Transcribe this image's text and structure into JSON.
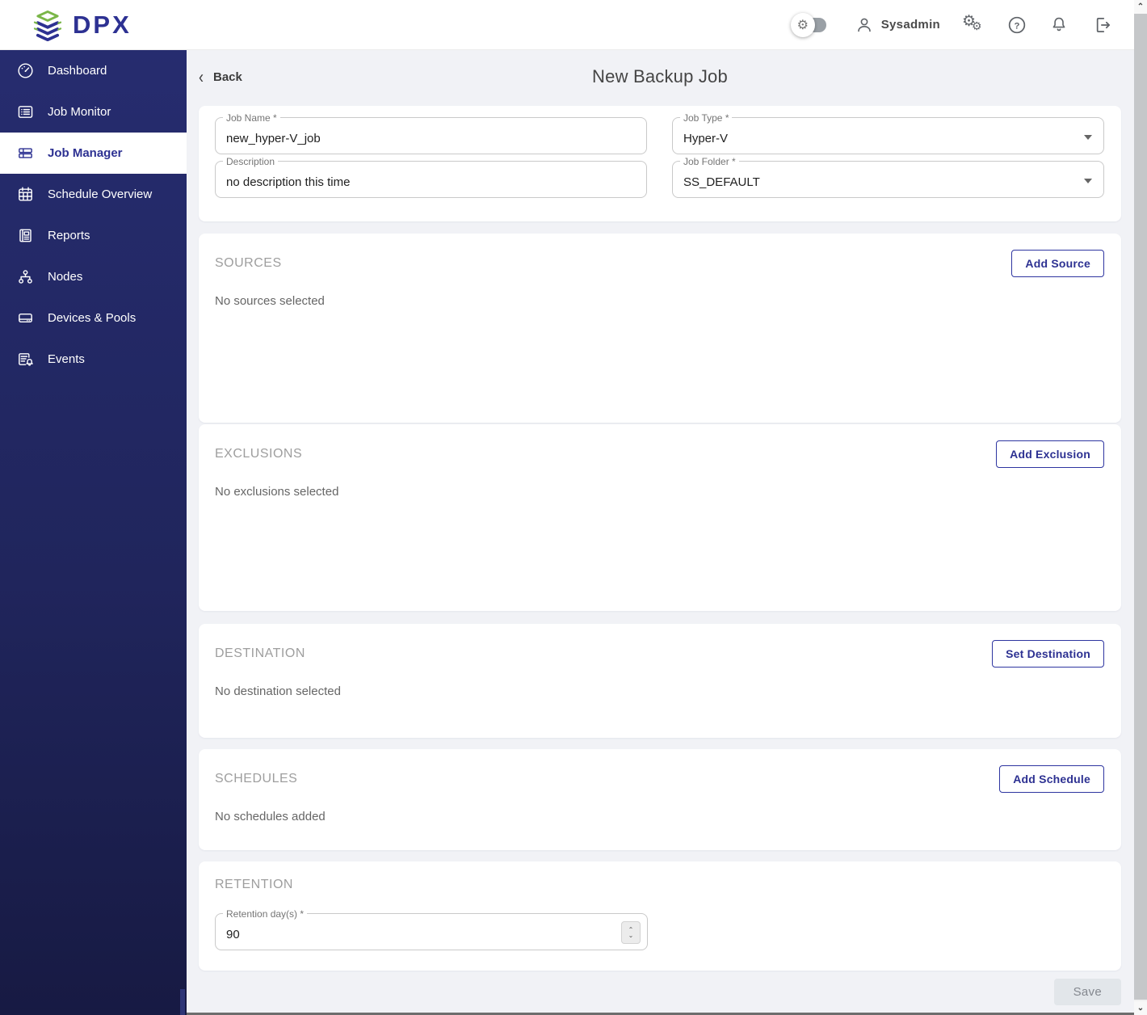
{
  "header": {
    "logo_text": "DPX",
    "user_name": "Sysadmin",
    "icons": {
      "toggle_knob": "gear-toggle-icon",
      "user": "person-icon",
      "settings": "double-gear-icon",
      "help": "question-circle-icon",
      "notifications": "bell-icon",
      "logout": "logout-icon"
    }
  },
  "sidebar": {
    "items": [
      {
        "label": "Dashboard",
        "icon": "dashboard-icon",
        "active": false
      },
      {
        "label": "Job Monitor",
        "icon": "job-monitor-icon",
        "active": false
      },
      {
        "label": "Job Manager",
        "icon": "job-manager-icon",
        "active": true
      },
      {
        "label": "Schedule Overview",
        "icon": "schedule-icon",
        "active": false
      },
      {
        "label": "Reports",
        "icon": "reports-icon",
        "active": false
      },
      {
        "label": "Nodes",
        "icon": "nodes-icon",
        "active": false
      },
      {
        "label": "Devices & Pools",
        "icon": "devices-icon",
        "active": false
      },
      {
        "label": "Events",
        "icon": "events-icon",
        "active": false
      }
    ]
  },
  "page": {
    "back_label": "Back",
    "title": "New Backup Job"
  },
  "form": {
    "job_name": {
      "label": "Job Name *",
      "value": "new_hyper-V_job"
    },
    "description": {
      "label": "Description",
      "value": "no description this time"
    },
    "job_type": {
      "label": "Job Type *",
      "value": "Hyper-V"
    },
    "job_folder": {
      "label": "Job Folder *",
      "value": "SS_DEFAULT"
    }
  },
  "sections": {
    "sources": {
      "title": "SOURCES",
      "button_label": "Add Source",
      "empty_text": "No sources selected"
    },
    "exclusions": {
      "title": "EXCLUSIONS",
      "button_label": "Add Exclusion",
      "empty_text": "No exclusions selected"
    },
    "destination": {
      "title": "DESTINATION",
      "button_label": "Set Destination",
      "empty_text": "No destination selected"
    },
    "schedules": {
      "title": "SCHEDULES",
      "button_label": "Add Schedule",
      "empty_text": "No schedules added"
    },
    "retention": {
      "title": "RETENTION",
      "field_label": "Retention day(s) *",
      "value": "90"
    }
  },
  "footer": {
    "save_label": "Save"
  },
  "colors": {
    "accent_indigo": "#2d3192",
    "logo_green": "#7ab648",
    "sidebar_top": "#262c6f",
    "sidebar_bottom": "#171a43",
    "page_background": "#f1f2f6",
    "card_background": "#ffffff",
    "section_title_gray": "#9e9e9e",
    "disabled_button_bg": "#e2e6ea"
  }
}
